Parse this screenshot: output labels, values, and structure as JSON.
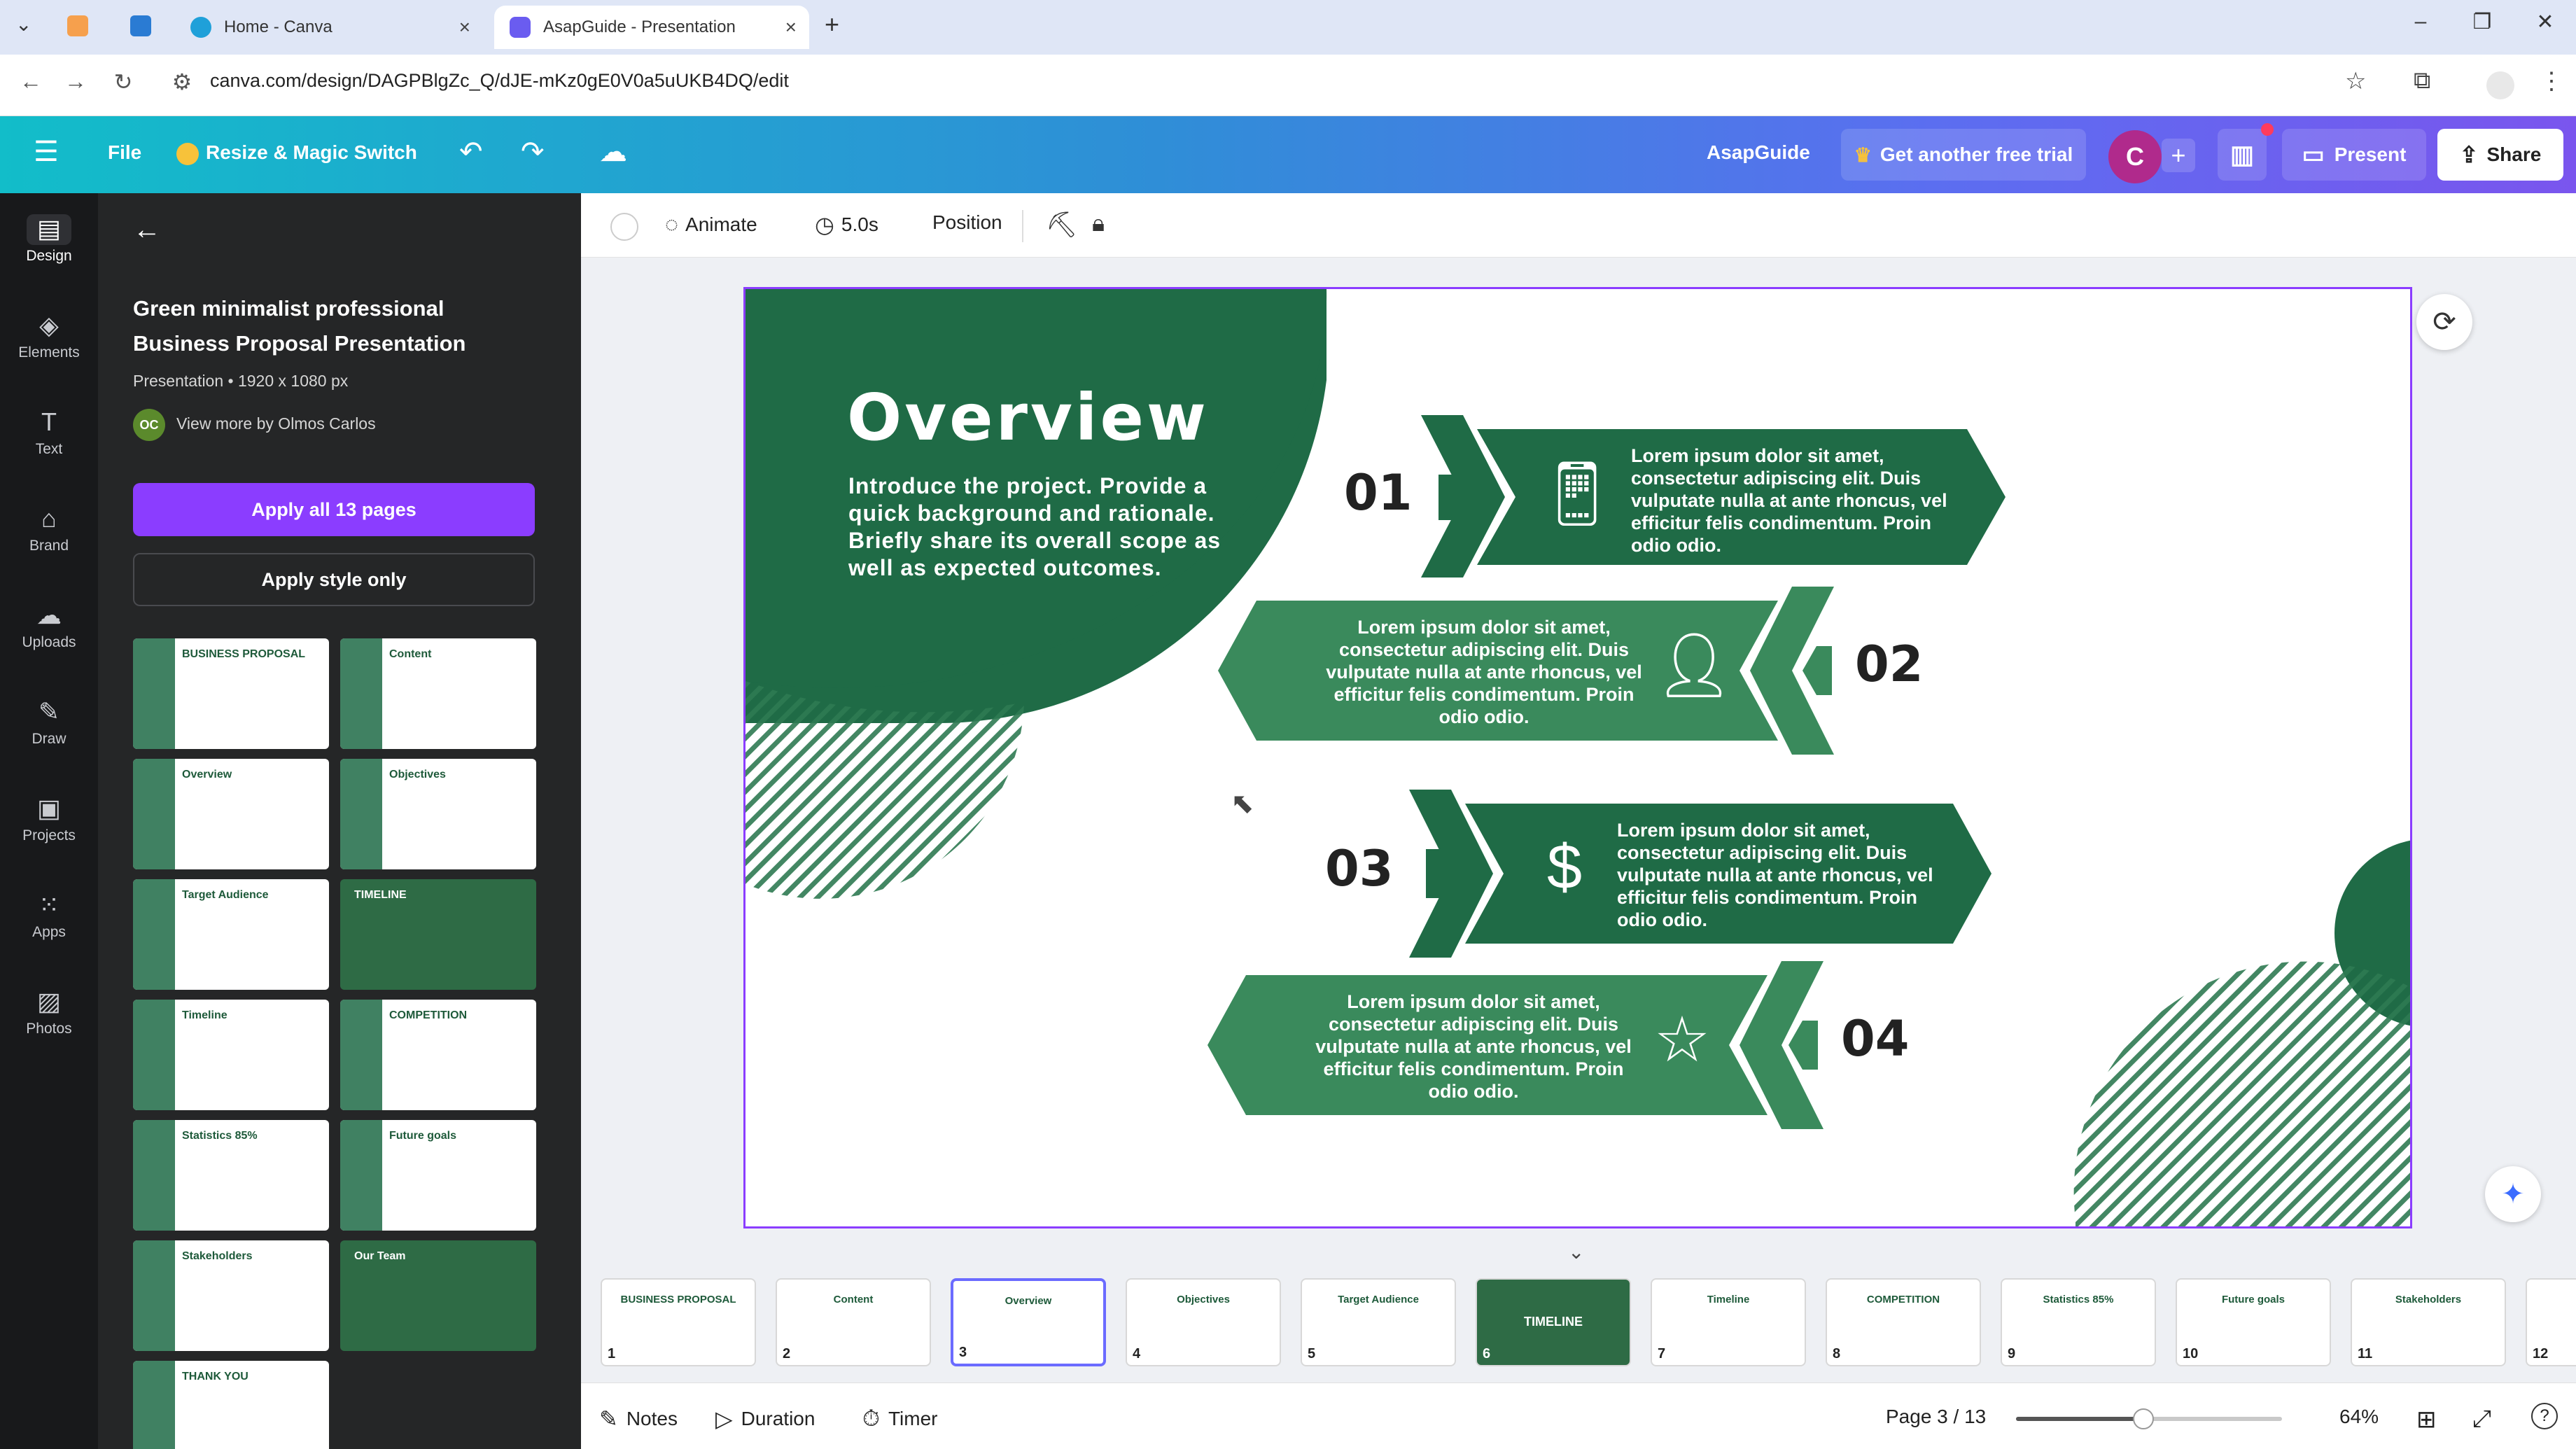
{
  "browser": {
    "tabs": [
      {
        "label": "Home - Canva"
      },
      {
        "label": "AsapGuide - Presentation"
      }
    ],
    "url": "canva.com/design/DAGPBlgZc_Q/dJE-mKz0gE0V0a5uUKB4DQ/edit"
  },
  "header": {
    "file": "File",
    "resize": "Resize & Magic Switch",
    "project_name": "AsapGuide",
    "trial": "Get another free trial",
    "avatar": "C",
    "present": "Present",
    "share": "Share"
  },
  "rail": [
    {
      "label": "Design",
      "icon": "design-icon"
    },
    {
      "label": "Elements",
      "icon": "elements-icon"
    },
    {
      "label": "Text",
      "icon": "text-icon"
    },
    {
      "label": "Brand",
      "icon": "brand-icon"
    },
    {
      "label": "Uploads",
      "icon": "uploads-icon"
    },
    {
      "label": "Draw",
      "icon": "draw-icon"
    },
    {
      "label": "Projects",
      "icon": "projects-icon"
    },
    {
      "label": "Apps",
      "icon": "apps-icon"
    },
    {
      "label": "Photos",
      "icon": "photos-icon"
    }
  ],
  "panel": {
    "title": "Green minimalist professional Business Proposal Presentation",
    "meta": "Presentation • 1920 x 1080 px",
    "author_initials": "OC",
    "author_link": "View more by Olmos Carlos",
    "apply_all": "Apply all 13 pages",
    "apply_style": "Apply style only",
    "thumbs": [
      {
        "label": "BUSINESS PROPOSAL",
        "dark": false
      },
      {
        "label": "Content",
        "dark": false
      },
      {
        "label": "Overview",
        "dark": false
      },
      {
        "label": "Objectives",
        "dark": false
      },
      {
        "label": "Target Audience",
        "dark": false
      },
      {
        "label": "TIMELINE",
        "dark": true
      },
      {
        "label": "Timeline",
        "dark": false
      },
      {
        "label": "COMPETITION",
        "dark": false
      },
      {
        "label": "Statistics 85%",
        "dark": false
      },
      {
        "label": "Future goals",
        "dark": false
      },
      {
        "label": "Stakeholders",
        "dark": false
      },
      {
        "label": "Our Team",
        "dark": true
      },
      {
        "label": "THANK YOU",
        "dark": false
      }
    ]
  },
  "toolbar": {
    "animate": "Animate",
    "duration": "5.0s",
    "position": "Position"
  },
  "slide": {
    "title": "Overview",
    "intro": "Introduce the project. Provide a quick background and rationale. Briefly share its overall scope as well as expected outcomes.",
    "items": [
      {
        "num": "01",
        "text": "Lorem ipsum dolor sit amet, consectetur adipiscing elit. Duis vulputate nulla at ante rhoncus, vel efficitur felis condimentum. Proin odio odio.",
        "icon": "megaphone-phone-icon"
      },
      {
        "num": "02",
        "text": "Lorem ipsum dolor sit amet, consectetur adipiscing elit. Duis vulputate nulla at ante rhoncus, vel efficitur felis condimentum. Proin odio odio.",
        "icon": "businessman-dollar-icon"
      },
      {
        "num": "03",
        "text": "Lorem ipsum dolor sit amet, consectetur adipiscing elit. Duis vulputate nulla at ante rhoncus, vel efficitur felis condimentum. Proin odio odio.",
        "icon": "money-bag-exchange-icon"
      },
      {
        "num": "04",
        "text": "Lorem ipsum dolor sit amet, consectetur adipiscing elit. Duis vulputate nulla at ante rhoncus, vel efficitur felis condimentum. Proin odio odio.",
        "icon": "customer-rating-icon"
      }
    ],
    "colors": {
      "dark_green": "#1f6b46",
      "mid_green": "#3a8a5c",
      "hatch": "#2e7a52"
    }
  },
  "filmstrip": [
    {
      "n": "1",
      "label": "BUSINESS PROPOSAL",
      "dark": false
    },
    {
      "n": "2",
      "label": "Content",
      "dark": false
    },
    {
      "n": "3",
      "label": "Overview",
      "dark": false,
      "selected": true
    },
    {
      "n": "4",
      "label": "Objectives",
      "dark": false
    },
    {
      "n": "5",
      "label": "Target Audience",
      "dark": false
    },
    {
      "n": "6",
      "label": "TIMELINE",
      "dark": true
    },
    {
      "n": "7",
      "label": "Timeline",
      "dark": false
    },
    {
      "n": "8",
      "label": "COMPETITION",
      "dark": false
    },
    {
      "n": "9",
      "label": "Statistics 85%",
      "dark": false
    },
    {
      "n": "10",
      "label": "Future goals",
      "dark": false
    },
    {
      "n": "11",
      "label": "Stakeholders",
      "dark": false
    },
    {
      "n": "12",
      "label": "",
      "dark": false
    }
  ],
  "bottom": {
    "notes": "Notes",
    "duration": "Duration",
    "timer": "Timer",
    "page": "Page 3 / 13",
    "zoom": "64%",
    "zoom_level": 0.48
  }
}
